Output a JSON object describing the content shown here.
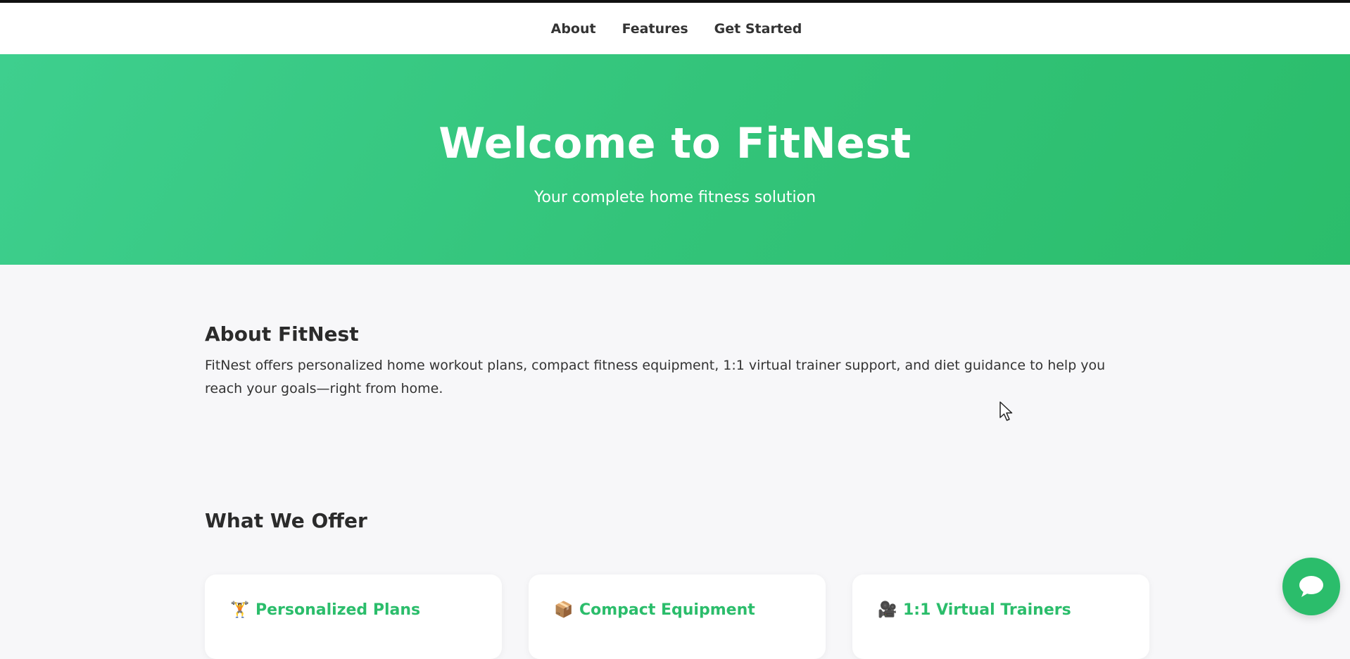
{
  "nav": {
    "items": [
      {
        "label": "About"
      },
      {
        "label": "Features"
      },
      {
        "label": "Get Started"
      }
    ]
  },
  "hero": {
    "title": "Welcome to FitNest",
    "subtitle": "Your complete home fitness solution"
  },
  "about": {
    "heading": "About FitNest",
    "text": "FitNest offers personalized home workout plans, compact fitness equipment, 1:1 virtual trainer support, and diet guidance to help you reach your goals—right from home."
  },
  "offer": {
    "heading": "What We Offer",
    "cards": [
      {
        "emoji": "🏋️",
        "title": "Personalized Plans"
      },
      {
        "emoji": "📦",
        "title": "Compact Equipment"
      },
      {
        "emoji": "🎥",
        "title": "1:1 Virtual Trainers"
      }
    ]
  },
  "colors": {
    "accent": "#2bbd6b",
    "hero_start": "#3ecf8e",
    "background": "#f7f7f9"
  },
  "icons": {
    "chat": "chat-bubble-icon",
    "cursor": "mouse-pointer-icon"
  }
}
